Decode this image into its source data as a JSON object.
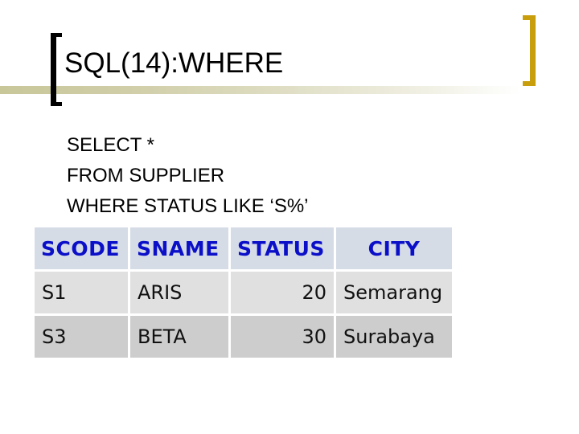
{
  "slide": {
    "title": "SQL(14):WHERE",
    "accent_color": "#c99e0c",
    "query_lines": [
      "SELECT *",
      "FROM SUPPLIER",
      "WHERE STATUS LIKE ‘S%’"
    ]
  },
  "result_table": {
    "header_color": "#0b10c8",
    "columns": [
      "SCODE",
      "SNAME",
      "STATUS",
      "CITY"
    ],
    "rows": [
      [
        "S1",
        "ARIS",
        "20",
        "Semarang"
      ],
      [
        "S3",
        "BETA",
        "30",
        "Surabaya"
      ]
    ]
  }
}
